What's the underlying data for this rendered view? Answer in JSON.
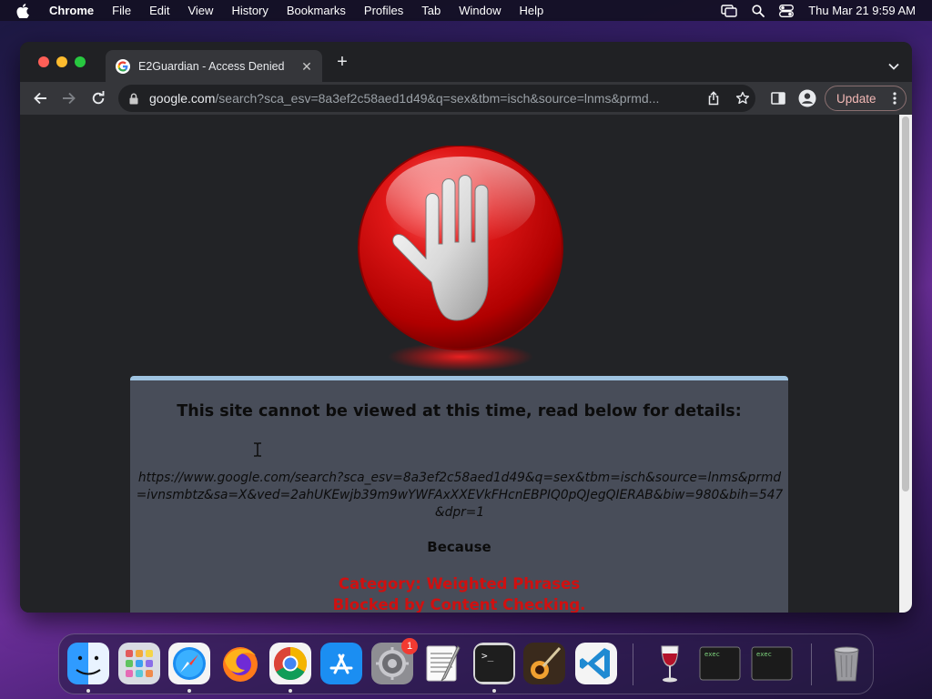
{
  "menubar": {
    "app_name": "Chrome",
    "items": [
      "File",
      "Edit",
      "View",
      "History",
      "Bookmarks",
      "Profiles",
      "Tab",
      "Window",
      "Help"
    ],
    "clock": "Thu Mar 21  9:59 AM"
  },
  "browser": {
    "tab_title": "E2Guardian - Access Denied",
    "url_host": "google.com",
    "url_path": "/search?sca_esv=8a3ef2c58aed1d49&q=sex&tbm=isch&source=lnms&prmd...",
    "update_label": "Update"
  },
  "page": {
    "headline": "This site cannot be viewed at this time, read below for details:",
    "blocked_url": "https://www.google.com/search?sca_esv=8a3ef2c58aed1d49&q=sex&tbm=isch&source=lnms&prmd=ivnsmbtz&sa=X&ved=2ahUKEwjb39m9wYWFAxXXEVkFHcnEBPIQ0pQJegQIERAB&biw=980&bih=547&dpr=1",
    "because_label": "Because",
    "category": "Category: Weighted Phrases",
    "reason": "Blocked by Content Checking."
  },
  "dock": {
    "settings_badge": "1",
    "terminal_prompt": ">_",
    "exec_label": "exec"
  },
  "colors": {
    "reason_red": "#d01010",
    "content_box": "#484d59",
    "box_top_border": "#9ec3e0"
  }
}
